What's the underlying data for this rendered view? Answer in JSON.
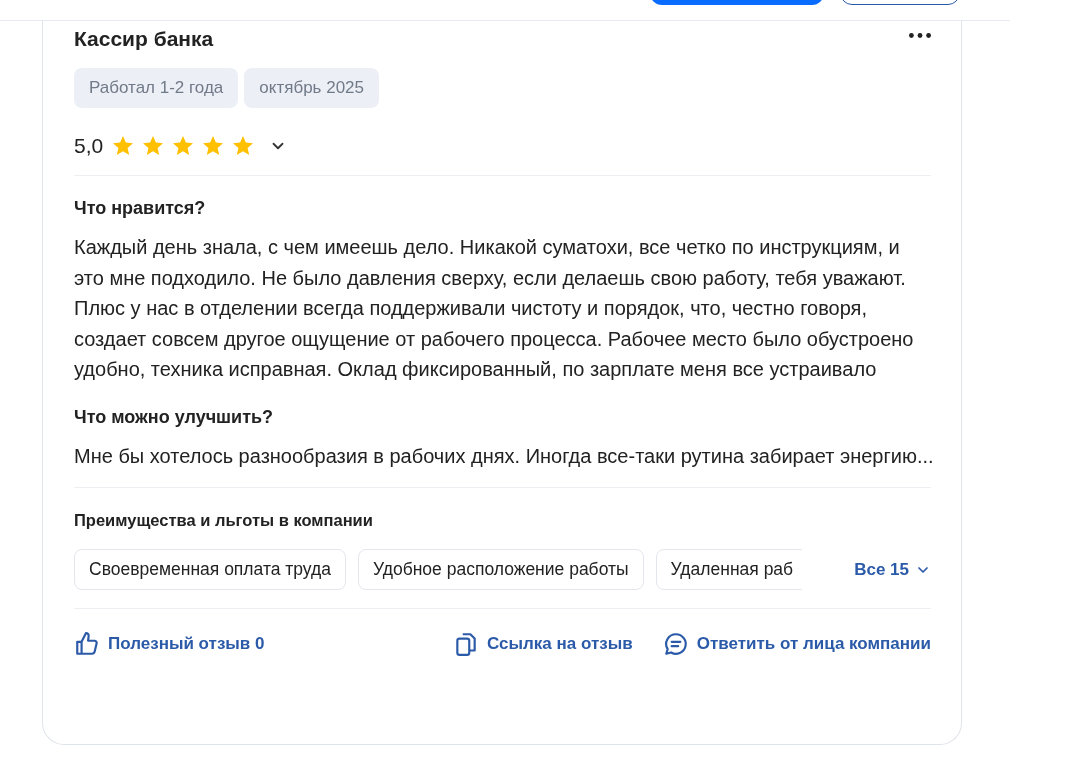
{
  "review": {
    "title": "Кассир банка",
    "tags": [
      "Работал 1-2 года",
      "октябрь 2025"
    ],
    "rating": {
      "score": "5,0",
      "stars": 5
    },
    "sections": [
      {
        "heading": "Что нравится?",
        "text": "Каждый день знала, с чем имеешь дело. Никакой суматохи, все четко по инструкциям, и это мне подходило. Не было давления сверху, если делаешь свою работу, тебя уважают. Плюс у нас в отделении всегда поддерживали чистоту и порядок, что, честно говоря, создает совсем другое ощущение от рабочего процесса. Рабочее место было обустроено удобно, техника исправная. Оклад фиксированный, по зарплате меня все устраивало"
      },
      {
        "heading": "Что можно улучшить?",
        "text": "Мне бы хотелось разнообразия в рабочих днях. Иногда все-таки рутина забирает энергию..."
      }
    ],
    "benefits": {
      "heading": "Преимущества и льготы в компании",
      "chips": [
        "Своевременная оплата труда",
        "Удобное расположение работы",
        "Удаленная раб"
      ],
      "more": "Все 15"
    },
    "actions": [
      {
        "kind": "like",
        "label": "Полезный отзыв 0"
      },
      {
        "kind": "link",
        "label": "Ссылка на отзыв"
      },
      {
        "kind": "reply",
        "label": "Ответить от лица компании"
      }
    ]
  }
}
